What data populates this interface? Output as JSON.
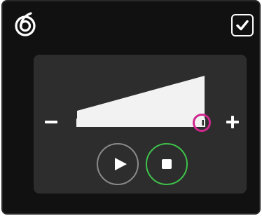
{
  "icons": {
    "app_logo": "swirl-logo-icon",
    "confirm": "checkmark-icon",
    "decrease": "minus-icon",
    "increase": "plus-icon",
    "play": "play-icon",
    "stop": "stop-icon"
  },
  "volume_slider": {
    "value": 0.98
  },
  "colors": {
    "background": "#111111",
    "panel": "#2d2d2d",
    "ramp_fill": "#f2f2f2",
    "knob_ring": "#d0278e",
    "stop_ring": "#3ec24a",
    "play_ring": "#8a8a8a"
  }
}
